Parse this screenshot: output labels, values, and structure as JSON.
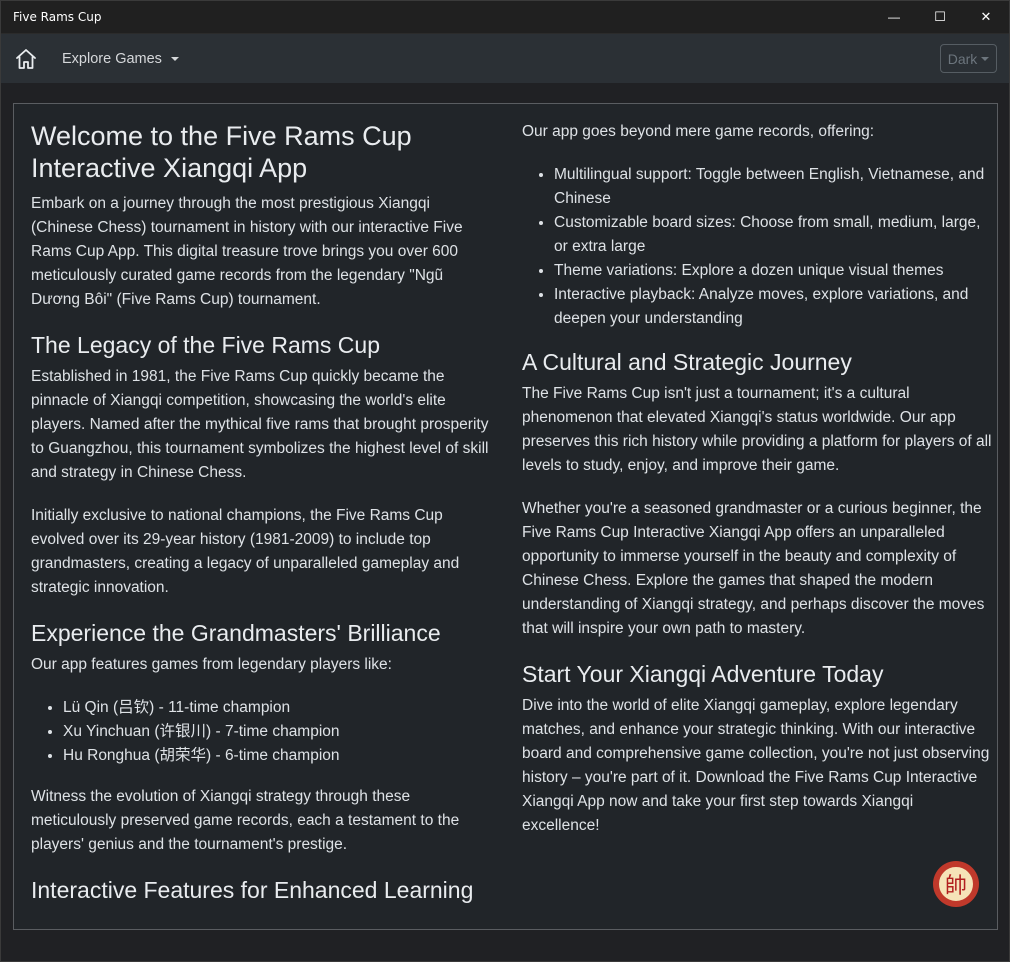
{
  "window": {
    "title": "Five Rams Cup",
    "minimize_glyph": "—",
    "maximize_glyph": "☐",
    "close_glyph": "✕"
  },
  "navbar": {
    "home_icon": "home-icon",
    "explore_label": "Explore Games",
    "theme_label": "Dark"
  },
  "left": {
    "welcome_title": "Welcome to the Five Rams Cup Interactive Xiangqi App",
    "welcome_text": "Embark on a journey through the most prestigious Xiangqi (Chinese Chess) tournament in history with our interactive Five Rams Cup App. This digital treasure trove brings you over 600 meticulously curated game records from the legendary \"Ngũ Dương Bôi\" (Five Rams Cup) tournament.",
    "legacy_title": "The Legacy of the Five Rams Cup",
    "legacy_p1": "Established in 1981, the Five Rams Cup quickly became the pinnacle of Xiangqi competition, showcasing the world's elite players. Named after the mythical five rams that brought prosperity to Guangzhou, this tournament symbolizes the highest level of skill and strategy in Chinese Chess.",
    "legacy_p2": "Initially exclusive to national champions, the Five Rams Cup evolved over its 29-year history (1981-2009) to include top grandmasters, creating a legacy of unparalleled gameplay and strategic innovation.",
    "experience_title": "Experience the Grandmasters' Brilliance",
    "experience_intro": "Our app features games from legendary players like:",
    "players": [
      "Lü Qin (吕钦) - 11-time champion",
      "Xu Yinchuan (许银川) - 7-time champion",
      "Hu Ronghua (胡荣华) - 6-time champion"
    ],
    "experience_outro": "Witness the evolution of Xiangqi strategy through these meticulously preserved game records, each a testament to the players' genius and the tournament's prestige.",
    "features_title": "Interactive Features for Enhanced Learning"
  },
  "right": {
    "features_intro": "Our app goes beyond mere game records, offering:",
    "features": [
      "Multilingual support: Toggle between English, Vietnamese, and Chinese",
      "Customizable board sizes: Choose from small, medium, large, or extra large",
      "Theme variations: Explore a dozen unique visual themes",
      "Interactive playback: Analyze moves, explore variations, and deepen your understanding"
    ],
    "journey_title": "A Cultural and Strategic Journey",
    "journey_p1": "The Five Rams Cup isn't just a tournament; it's a cultural phenomenon that elevated Xiangqi's status worldwide. Our app preserves this rich history while providing a platform for players of all levels to study, enjoy, and improve their game.",
    "journey_p2": "Whether you're a seasoned grandmaster or a curious beginner, the Five Rams Cup Interactive Xiangqi App offers an unparalleled opportunity to immerse yourself in the beauty and complexity of Chinese Chess. Explore the games that shaped the modern understanding of Xiangqi strategy, and perhaps discover the moves that will inspire your own path to mastery.",
    "start_title": "Start Your Xiangqi Adventure Today",
    "start_p": "Dive into the world of elite Xiangqi gameplay, explore legendary matches, and enhance your strategic thinking. With our interactive board and comprehensive game collection, you're not just observing history – you're part of it. Download the Five Rams Cup Interactive Xiangqi App now and take your first step towards Xiangqi excellence!"
  },
  "fab": {
    "glyph": "帥",
    "icon": "xiangqi-general-piece-icon"
  },
  "colors": {
    "navbar_bg": "#2b3035",
    "content_bg": "#212529",
    "fab_red": "#c0392b",
    "fab_face": "#f6e3b8"
  }
}
